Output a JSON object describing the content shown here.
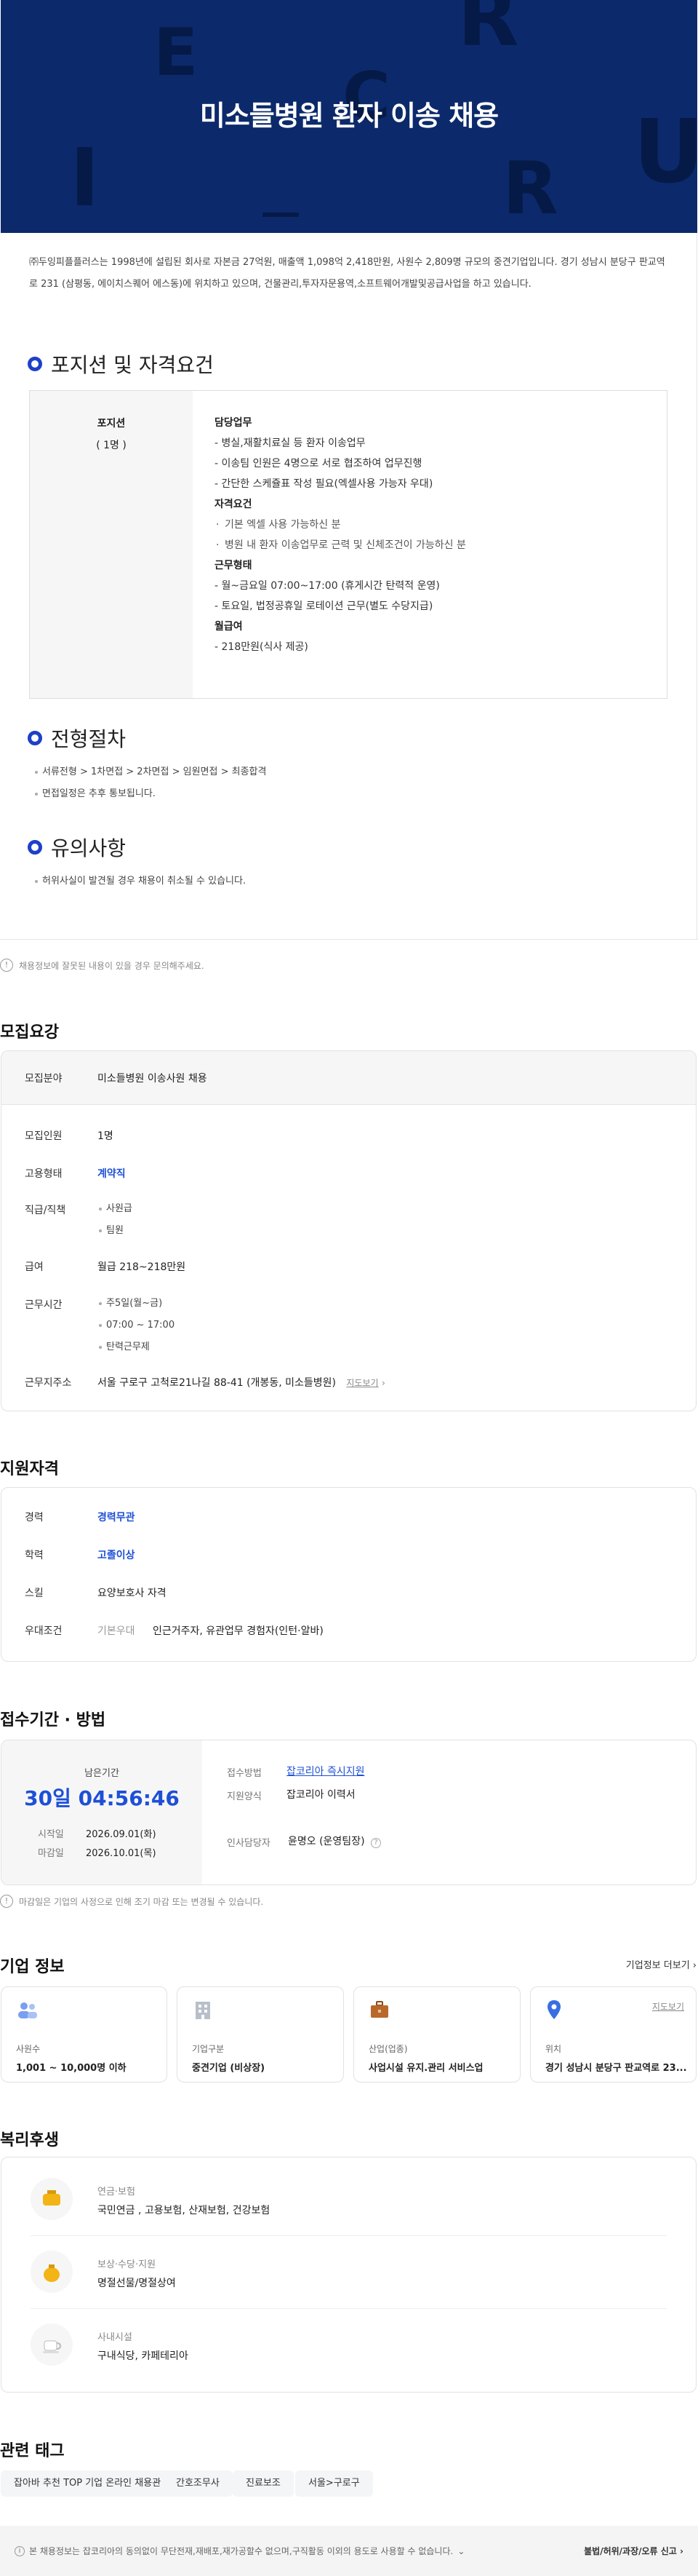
{
  "hero": {
    "title": "미소들병원 환자 이송 채용",
    "ghost_letters": [
      "E",
      "R",
      "C",
      "U",
      "I",
      "R"
    ]
  },
  "company_desc": "㈜두잉피플플러스는 1998년에 설립된 회사로 자본금 27억원, 매출액 1,098억 2,418만원, 사원수 2,809명 규모의 중견기업입니다. 경기 성남시 분당구 판교역로 231 (삼평동, 에이치스퀘어 에스동)에 위치하고 있으며, 건물관리,투자자문용역,소프트웨어개발및공급사업을 하고 있습니다.",
  "position": {
    "section_title": "포지션 및 자격요건",
    "label": "포지션",
    "count": "( 1명 )",
    "duty_title": "담당업무",
    "duties": [
      "- 병실,재활치료실 등 환자 이송업무",
      "- 이송팀 인원은 4명으로 서로 협조하여 업무진행",
      "- 간단한 스케쥴표 작성 필요(엑셀사용 가능자 우대)"
    ],
    "qual_title": "자격요건",
    "quals": [
      "기본 엑셀 사용 가능하신 분",
      "병원 내 환자 이송업무로 근력 및 신체조건이 가능하신 분"
    ],
    "work_title": "근무형태",
    "works": [
      "- 월~금요일 07:00~17:00 (휴게시간 탄력적 운영)",
      "- 토요일, 법정공휴일 로테이션 근무(별도 수당지급)"
    ],
    "pay_title": "월급여",
    "pays": [
      "- 218만원(식사 제공)"
    ]
  },
  "process": {
    "section_title": "전형절차",
    "lines": [
      "서류전형 > 1차면접 > 2차면접 > 임원면접 > 최종합격",
      "면접일정은 추후 통보됩니다."
    ]
  },
  "caution": {
    "section_title": "유의사항",
    "lines": [
      "허위사실이 발견될 경우 채용이 취소될 수 있습니다."
    ]
  },
  "report_notice": "채용정보에 잘못된 내용이 있을 경우 문의해주세요.",
  "recruit": {
    "title": "모집요강",
    "field_label": "모집분야",
    "field_value": "미소들병원 이송사원 채용",
    "count_label": "모집인원",
    "count_value": "1명",
    "type_label": "고용형태",
    "type_value": "계약직",
    "rank_label": "직급/직책",
    "ranks": [
      "사원급",
      "팀원"
    ],
    "salary_label": "급여",
    "salary_value": "월급 218~218만원",
    "hours_label": "근무시간",
    "hours": [
      "주5일(월~금)",
      "07:00 ~ 17:00",
      "탄력근무제"
    ],
    "addr_label": "근무지주소",
    "addr_value": "서울 구로구 고척로21나길 88-41 (개봉동, 미소들병원)",
    "map_link": "지도보기"
  },
  "qualify": {
    "title": "지원자격",
    "career_label": "경력",
    "career_value": "경력무관",
    "edu_label": "학력",
    "edu_value": "고졸이상",
    "skill_label": "스킬",
    "skill_value": "요양보호사 자격",
    "pref_label": "우대조건",
    "pref_sub": "기본우대",
    "pref_value": "인근거주자, 유관업무 경험자(인턴·알바)"
  },
  "apply": {
    "title": "접수기간 · 방법",
    "remain_label": "남은기간",
    "remain_value": "30일 04:56:46",
    "start_label": "시작일",
    "start_value": "2026.09.01(화)",
    "end_label": "마감일",
    "end_value": "2026.10.01(목)",
    "method_label": "접수방법",
    "method_value": "잡코리아 즉시지원",
    "form_label": "지원양식",
    "form_value": "잡코리아 이력서",
    "manager_label": "인사담당자",
    "manager_value": "윤명오 (운영팀장)",
    "notice": "마감일은 기업의 사정으로 인해 조기 마감 또는 변경될 수 있습니다."
  },
  "company": {
    "title": "기업 정보",
    "more_link": "기업정보 더보기",
    "cards": [
      {
        "label": "사원수",
        "value": "1,001 ~ 10,000명 이하",
        "icon": "people-icon"
      },
      {
        "label": "기업구분",
        "value": "중견기업 (비상장)",
        "icon": "building-icon"
      },
      {
        "label": "산업(업종)",
        "value": "사업시설 유지.관리 서비스업",
        "icon": "briefcase-icon"
      },
      {
        "label": "위치",
        "value": "경기 성남시 분당구 판교역로 23...",
        "icon": "pin-icon",
        "link": "지도보기"
      }
    ]
  },
  "welfare": {
    "title": "복리후생",
    "items": [
      {
        "category": "연금·보험",
        "value": "국민연금 , 고용보험, 산재보험, 건강보험",
        "icon": "piggy-bank-icon"
      },
      {
        "category": "보상·수당·지원",
        "value": "명절선물/명절상여",
        "icon": "money-bag-icon"
      },
      {
        "category": "사내시설",
        "value": "구내식당, 카페테리아",
        "icon": "coffee-icon"
      }
    ]
  },
  "tags": {
    "title": "관련 태그",
    "items": [
      "잡아바 추천 TOP 기업 온라인 채용관",
      "간호조무사",
      "진료보조",
      "서울>구로구"
    ]
  },
  "footer": {
    "text": "본 채용정보는 잡코리아의 동의없이 무단전재,재배포,재가공할수 없으며,구직활동 이외의 용도로 사용할 수 없습니다.",
    "report": "불법/허위/과장/오류 신고"
  },
  "colors": {
    "hero_bg": "#0c2a6b",
    "accent": "#1e50d6"
  }
}
